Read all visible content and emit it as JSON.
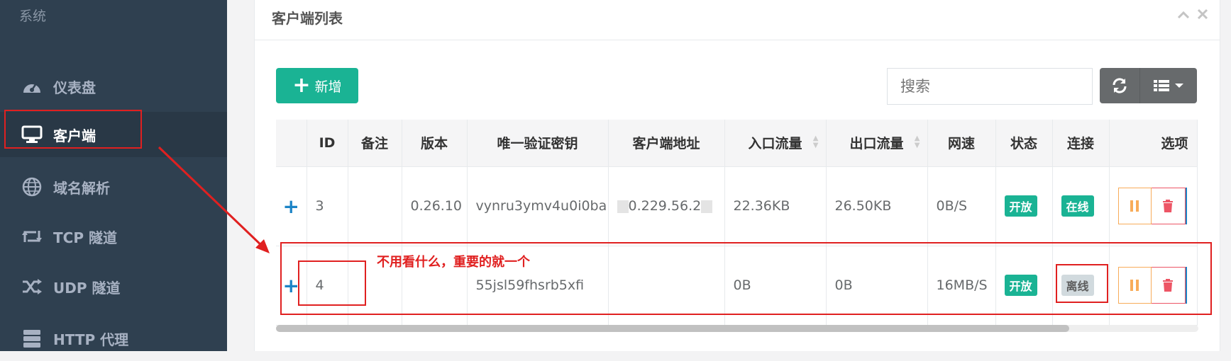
{
  "sidebar": {
    "system_label": "系统",
    "items": [
      {
        "label": "仪表盘",
        "icon": "dashboard-icon"
      },
      {
        "label": "客户端",
        "icon": "monitor-icon"
      },
      {
        "label": "域名解析",
        "icon": "globe-icon"
      },
      {
        "label": "TCP 隧道",
        "icon": "retweet-icon"
      },
      {
        "label": "UDP 隧道",
        "icon": "random-icon"
      },
      {
        "label": "HTTP 代理",
        "icon": "server-icon"
      }
    ]
  },
  "card": {
    "title": "客户端列表"
  },
  "toolbar": {
    "add_label": "新增",
    "search_placeholder": "搜索"
  },
  "table": {
    "columns": [
      "ID",
      "备注",
      "版本",
      "唯一验证密钥",
      "客户端地址",
      "入口流量",
      "出口流量",
      "网速",
      "状态",
      "连接",
      "选项"
    ],
    "rows": [
      {
        "id": "3",
        "remark": "",
        "version": "0.26.10",
        "key": "vynru3ymv4u0i0ba",
        "address": "0.229.56.2",
        "in": "22.36KB",
        "out": "26.50KB",
        "speed": "0B/S",
        "status": "开放",
        "conn": "在线"
      },
      {
        "id": "4",
        "remark": "",
        "version": "",
        "key": "55jsl59fhsrb5xfi",
        "address": "",
        "in": "0B",
        "out": "0B",
        "speed": "16MB/S",
        "status": "开放",
        "conn": "离线"
      }
    ]
  },
  "annotation": {
    "note": "不用看什么，重要的就一个"
  },
  "colors": {
    "sidebar_bg": "#2f4050",
    "accent": "#1ab394",
    "annotation_red": "#e02020"
  }
}
